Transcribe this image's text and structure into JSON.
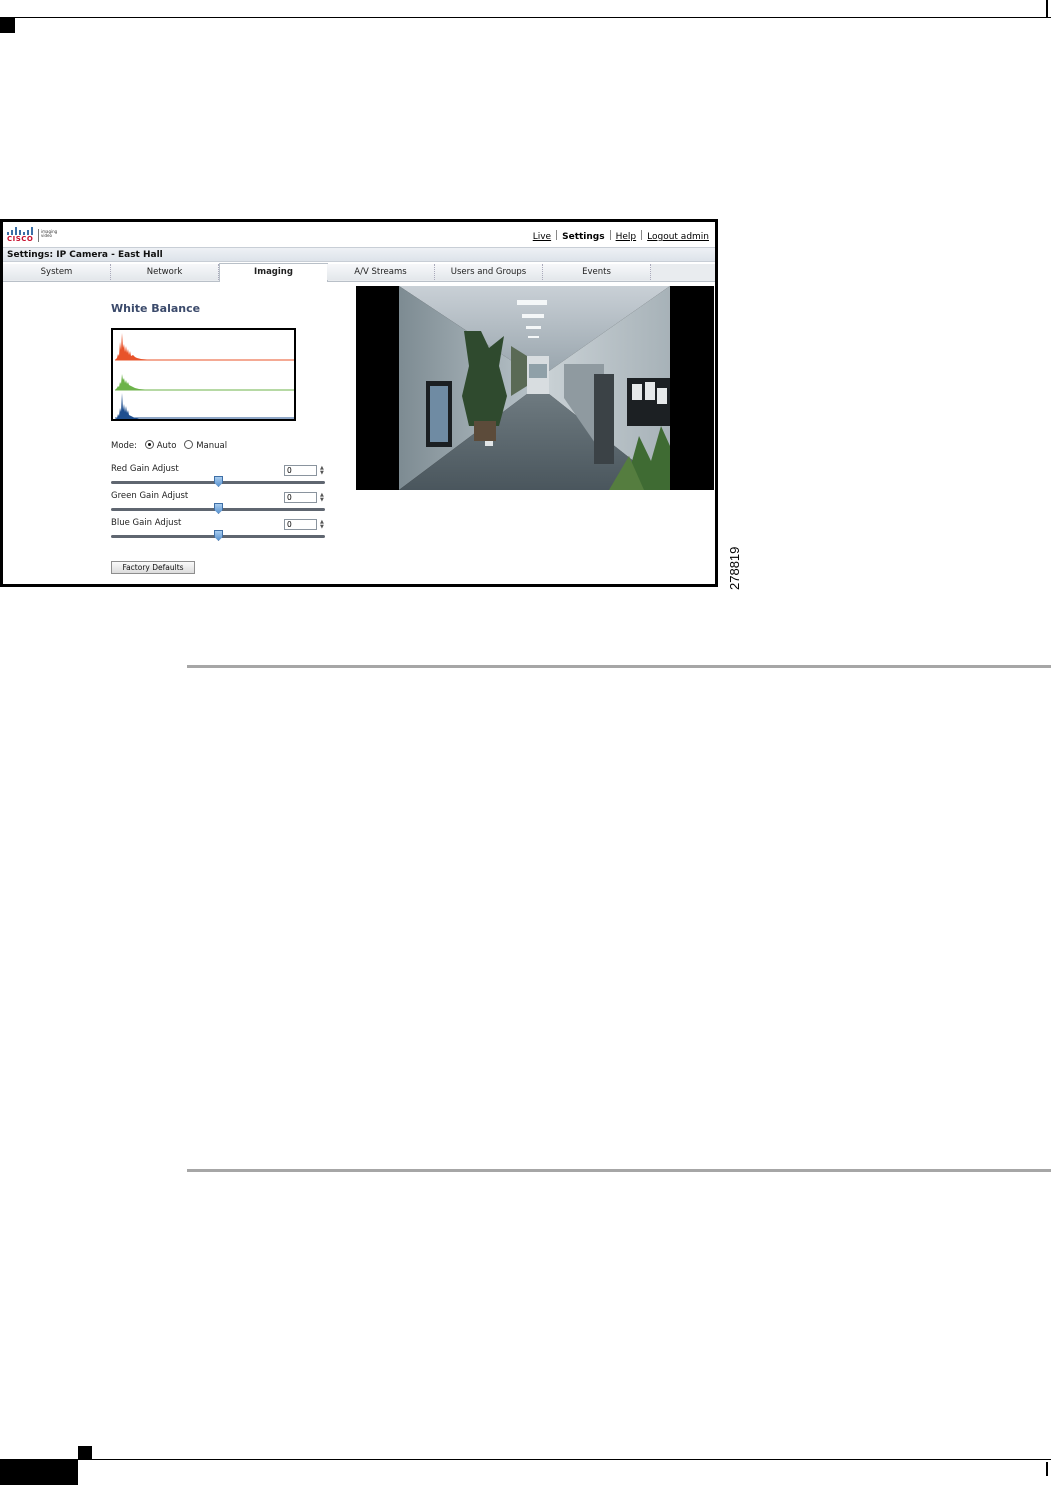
{
  "app": {
    "brand": "CISCO",
    "brand_sub": "imaging video",
    "nav_links": [
      "Live",
      "Settings",
      "Help",
      "Logout admin"
    ],
    "active_link": "Settings",
    "page_title": "Settings: IP Camera - East Hall"
  },
  "tabs": [
    {
      "label": "System",
      "active": false
    },
    {
      "label": "Network",
      "active": false
    },
    {
      "label": "Imaging",
      "active": true
    },
    {
      "label": "A/V Streams",
      "active": false
    },
    {
      "label": "Users and Groups",
      "active": false
    },
    {
      "label": "Events",
      "active": false
    }
  ],
  "white_balance": {
    "title": "White Balance",
    "mode_label": "Mode:",
    "mode_options": [
      "Auto",
      "Manual"
    ],
    "mode_selected": "Auto",
    "gains": [
      {
        "label": "Red Gain Adjust",
        "value": "0",
        "slider_fraction": 0.5
      },
      {
        "label": "Green Gain Adjust",
        "value": "0",
        "slider_fraction": 0.5
      },
      {
        "label": "Blue Gain Adjust",
        "value": "0",
        "slider_fraction": 0.5
      }
    ],
    "defaults_button": "Factory Defaults",
    "histogram_colors": {
      "red": "#e8532a",
      "green": "#6db34a",
      "blue": "#1f4f8f"
    }
  },
  "figure_id": "278819",
  "icons": {
    "spinner": "spin-arrows-icon",
    "slider_thumb": "slider-thumb-icon",
    "logo": "cisco-logo-icon"
  }
}
